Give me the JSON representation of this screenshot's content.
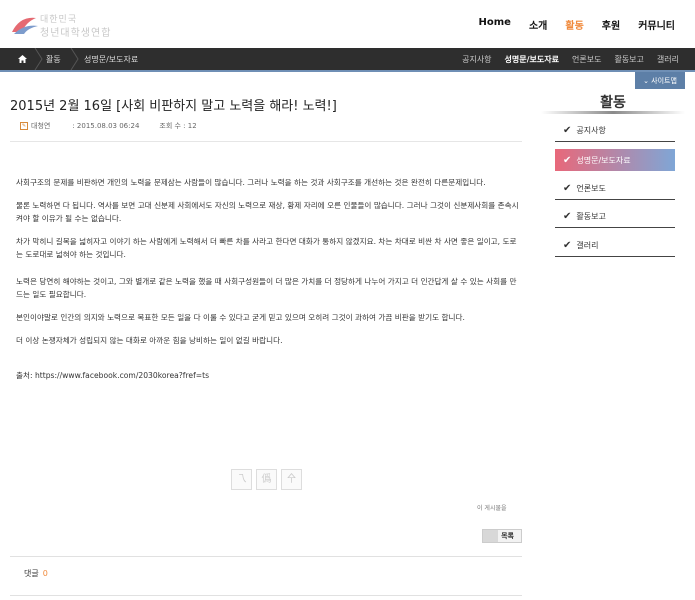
{
  "logo": {
    "line1": "대한민국",
    "line2": "청년대학생연합"
  },
  "gnb": [
    {
      "label": "Home",
      "active": false
    },
    {
      "label": "소개",
      "active": false
    },
    {
      "label": "활동",
      "active": true
    },
    {
      "label": "후원",
      "active": false
    },
    {
      "label": "커뮤니티",
      "active": false
    }
  ],
  "breadcrumb": {
    "home_icon": "home-icon",
    "level1": "활동",
    "level2": "성명문/보도자료"
  },
  "subnav": [
    {
      "label": "공지사항",
      "active": false
    },
    {
      "label": "성명문/보도자료",
      "active": true
    },
    {
      "label": "언론보도",
      "active": false
    },
    {
      "label": "활동보고",
      "active": false
    },
    {
      "label": "갤러리",
      "active": false
    }
  ],
  "sitemap_label": "⌄ 사이트맵",
  "post": {
    "title": "2015년 2월 16일 [사회 비판하지 말고 노력을 해라! 노력!]",
    "author": "대청연",
    "date": "2015.08.03 06:24",
    "views_label": "조회 수 : 12",
    "paragraphs": [
      "사회구조의 문제를 비판하면 개인의 노력을 문제삼는 사람들이 많습니다. 그러나 노력을 하는 것과 사회구조를 개선하는 것은 완전히 다른문제입니다.",
      "물론 노력하면 다 됩니다. 역사를 보면 고대 신분제 사회에서도 자신의 노력으로 재상, 황제 자리에 오른 인물들이 많습니다. 그러나 그것이 신분제사회를 존속시켜야 할 이유가 될 수는 없습니다.",
      "차가 막히니 길목을 넓히자고 이야기 하는 사람에게 노력해서 더 빠른 차를 사라고 한다면 대화가 통하지 않겠지요. 차는 차대로 비싼 차 사면 좋은 일이고, 도로는 도로대로 넓혀야 하는 것입니다.",
      "노력은 당연히 해야하는 것이고, 그와 별개로 같은 노력을 했을 때 사회구성원들이 더 많은 가치를 더 정당하게 나누어 가지고 더 인간답게 살 수 있는 사회를 만드는 일도 필요합니다.",
      "본인이야말로 인간의 의지와 노력으로 목표한 모든 일을 다 이룰 수 있다고 굳게 믿고 있으며 오히려 그것이 과하여 가끔 비판을 받기도 합니다.",
      "더 이상 논쟁자체가 성립되지 않는 대화로 아까운 힘을 낭비하는 일이 없길 바랍니다."
    ],
    "source": "출처: https://www.facebook.com/2030korea?fref=ts"
  },
  "share_buttons": [
    "乁",
    "僞",
    "㐃"
  ],
  "posts_by_author": "이 게시물을",
  "list_button": "목록",
  "comments": {
    "label": "댓글",
    "count": "0"
  },
  "sidebar": {
    "title": "활동",
    "items": [
      {
        "label": "공지사항",
        "active": false
      },
      {
        "label": "성명문/보도자료",
        "active": true
      },
      {
        "label": "언론보도",
        "active": false
      },
      {
        "label": "활동보고",
        "active": false
      },
      {
        "label": "갤러리",
        "active": false
      }
    ]
  },
  "colors": {
    "accent": "#f08a3c",
    "bar": "#2e2e2e",
    "blue": "#5d7fa7"
  }
}
